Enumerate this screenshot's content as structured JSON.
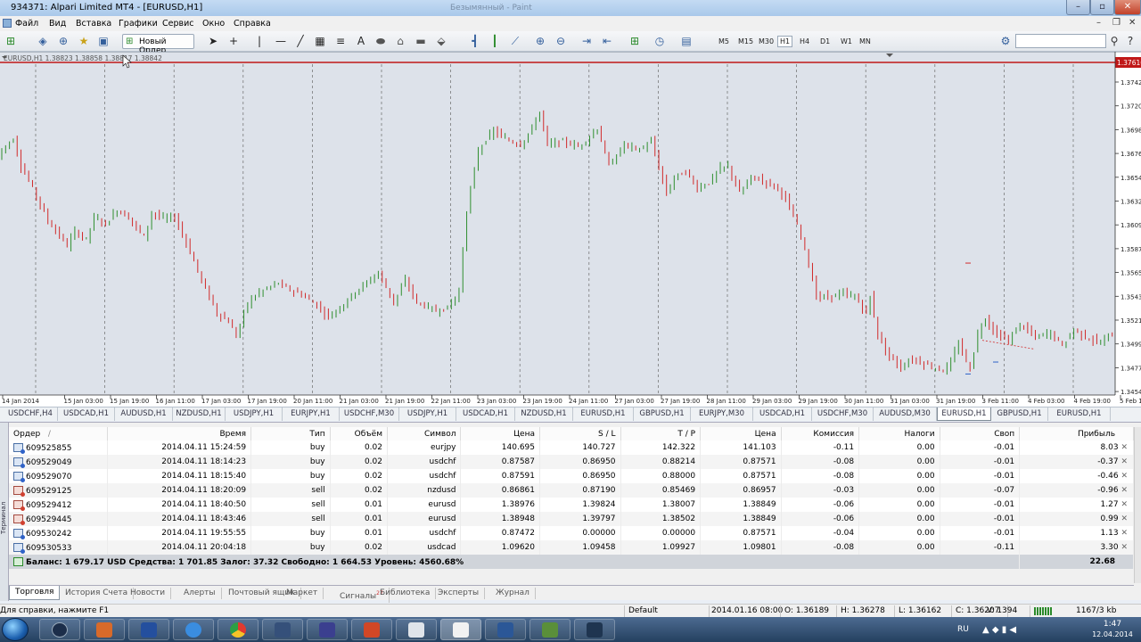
{
  "window": {
    "title": "934371: Alpari Limited MT4 - [EURUSD,H1]",
    "ghost_title": "Безымянный - Paint"
  },
  "menu": [
    "Файл",
    "Вид",
    "Вставка",
    "Графики",
    "Сервис",
    "Окно",
    "Справка"
  ],
  "toolbar": {
    "new_order_label": "Новый Ордер",
    "timeframes": [
      "M5",
      "M15",
      "M30",
      "H1",
      "H4",
      "D1",
      "W1",
      "MN"
    ],
    "active_timeframe": "H1"
  },
  "chart": {
    "header_text": "EURUSD,H1  1.38823 1.38858 1.38817 1.38842",
    "current_price": "1.37616",
    "bull_color": "#2f8f2f",
    "bear_color": "#d12b2b",
    "price_line_color": "#c01818",
    "price_labels": [
      "1.37425",
      "1.37205",
      "1.36985",
      "1.36760",
      "1.36540",
      "1.36320",
      "1.36095",
      "1.35875",
      "1.35655",
      "1.35430",
      "1.35210",
      "1.34990",
      "1.34770",
      "1.34545"
    ],
    "time_labels": [
      "14 Jan 2014",
      "15 Jan 03:00",
      "15 Jan 19:00",
      "16 Jan 11:00",
      "17 Jan 03:00",
      "17 Jan 19:00",
      "20 Jan 11:00",
      "21 Jan 03:00",
      "21 Jan 19:00",
      "22 Jan 11:00",
      "23 Jan 03:00",
      "23 Jan 19:00",
      "24 Jan 11:00",
      "27 Jan 03:00",
      "27 Jan 19:00",
      "28 Jan 11:00",
      "29 Jan 03:00",
      "29 Jan 19:00",
      "30 Jan 11:00",
      "31 Jan 03:00",
      "31 Jan 19:00",
      "3 Feb 11:00",
      "4 Feb 03:00",
      "4 Feb 19:00",
      "5 Feb 11:00"
    ],
    "path_points": [
      [
        1.3672,
        0
      ],
      [
        1.3681,
        1
      ],
      [
        1.369,
        4
      ],
      [
        1.3665,
        6
      ],
      [
        1.3645,
        9
      ],
      [
        1.3615,
        13
      ],
      [
        1.3592,
        18
      ],
      [
        1.3605,
        20
      ],
      [
        1.3598,
        23
      ],
      [
        1.3618,
        25
      ],
      [
        1.3612,
        28
      ],
      [
        1.3625,
        31
      ],
      [
        1.3618,
        34
      ],
      [
        1.36,
        38
      ],
      [
        1.3622,
        40
      ],
      [
        1.3617,
        43
      ],
      [
        1.3618,
        46
      ],
      [
        1.3595,
        49
      ],
      [
        1.356,
        53
      ],
      [
        1.353,
        57
      ],
      [
        1.3522,
        60
      ],
      [
        1.3509,
        62
      ],
      [
        1.354,
        65
      ],
      [
        1.3549,
        68
      ],
      [
        1.3558,
        73
      ],
      [
        1.3553,
        75
      ],
      [
        1.3547,
        79
      ],
      [
        1.3537,
        83
      ],
      [
        1.3527,
        86
      ],
      [
        1.3535,
        89
      ],
      [
        1.355,
        93
      ],
      [
        1.3558,
        96
      ],
      [
        1.3567,
        99
      ],
      [
        1.354,
        103
      ],
      [
        1.356,
        106
      ],
      [
        1.354,
        109
      ],
      [
        1.3532,
        114
      ],
      [
        1.3535,
        117
      ],
      [
        1.355,
        120
      ],
      [
        1.3625,
        122
      ],
      [
        1.368,
        125
      ],
      [
        1.3698,
        129
      ],
      [
        1.369,
        132
      ],
      [
        1.3685,
        136
      ],
      [
        1.37,
        139
      ],
      [
        1.3715,
        141
      ],
      [
        1.3685,
        143
      ],
      [
        1.3688,
        147
      ],
      [
        1.3683,
        151
      ],
      [
        1.3692,
        154
      ],
      [
        1.37,
        156
      ],
      [
        1.3665,
        159
      ],
      [
        1.3685,
        163
      ],
      [
        1.368,
        167
      ],
      [
        1.3688,
        170
      ],
      [
        1.364,
        174
      ],
      [
        1.3655,
        176
      ],
      [
        1.366,
        179
      ],
      [
        1.3645,
        182
      ],
      [
        1.365,
        185
      ],
      [
        1.3663,
        188
      ],
      [
        1.3665,
        190
      ],
      [
        1.364,
        193
      ],
      [
        1.3655,
        196
      ],
      [
        1.3652,
        199
      ],
      [
        1.3645,
        203
      ],
      [
        1.3635,
        205
      ],
      [
        1.361,
        208
      ],
      [
        1.359,
        210
      ],
      [
        1.3545,
        213
      ],
      [
        1.3545,
        216
      ],
      [
        1.3548,
        220
      ],
      [
        1.3545,
        223
      ],
      [
        1.353,
        226
      ],
      [
        1.3545,
        227
      ],
      [
        1.351,
        229
      ],
      [
        1.349,
        232
      ],
      [
        1.348,
        235
      ],
      [
        1.3488,
        238
      ],
      [
        1.3482,
        242
      ],
      [
        1.3477,
        246
      ],
      [
        1.3485,
        248
      ],
      [
        1.3502,
        250
      ],
      [
        1.3478,
        253
      ],
      [
        1.3512,
        255
      ],
      [
        1.3525,
        257
      ],
      [
        1.351,
        260
      ],
      [
        1.3505,
        263
      ],
      [
        1.352,
        266
      ],
      [
        1.3508,
        270
      ],
      [
        1.3512,
        274
      ],
      [
        1.35,
        277
      ],
      [
        1.3515,
        280
      ],
      [
        1.3508,
        283
      ],
      [
        1.3502,
        287
      ],
      [
        1.351,
        289
      ]
    ]
  },
  "chart_tabs": [
    "USDCHF,H4",
    "USDCAD,H1",
    "AUDUSD,H1",
    "NZDUSD,H1",
    "USDJPY,H1",
    "EURJPY,H1",
    "USDCHF,M30",
    "USDJPY,H1",
    "USDCAD,H1",
    "NZDUSD,H1",
    "EURUSD,H1",
    "GBPUSD,H1",
    "EURJPY,M30",
    "USDCAD,H1",
    "USDCHF,M30",
    "AUDUSD,M30",
    "EURUSD,H1",
    "GBPUSD,H1",
    "EURUSD,H1"
  ],
  "chart_tabs_active": 16,
  "terminal": {
    "side_label": "Терминал",
    "columns": [
      "Ордер",
      "/",
      "Время",
      "Тип",
      "Объём",
      "Символ",
      "Цена",
      "S / L",
      "T / P",
      "Цена",
      "Комиссия",
      "Налоги",
      "Своп",
      "Прибыль"
    ],
    "rows": [
      [
        "609525855",
        "",
        "2014.04.11 15:24:59",
        "buy",
        "0.02",
        "eurjpy",
        "140.695",
        "140.727",
        "142.322",
        "141.103",
        "-0.11",
        "0.00",
        "-0.01",
        "8.03"
      ],
      [
        "609529049",
        "",
        "2014.04.11 18:14:23",
        "buy",
        "0.02",
        "usdchf",
        "0.87587",
        "0.86950",
        "0.88214",
        "0.87571",
        "-0.08",
        "0.00",
        "-0.01",
        "-0.37"
      ],
      [
        "609529070",
        "",
        "2014.04.11 18:15:40",
        "buy",
        "0.02",
        "usdchf",
        "0.87591",
        "0.86950",
        "0.88000",
        "0.87571",
        "-0.08",
        "0.00",
        "-0.01",
        "-0.46"
      ],
      [
        "609529125",
        "",
        "2014.04.11 18:20:09",
        "sell",
        "0.02",
        "nzdusd",
        "0.86861",
        "0.87190",
        "0.85469",
        "0.86957",
        "-0.03",
        "0.00",
        "-0.07",
        "-0.96"
      ],
      [
        "609529412",
        "",
        "2014.04.11 18:40:50",
        "sell",
        "0.01",
        "eurusd",
        "1.38976",
        "1.39824",
        "1.38007",
        "1.38849",
        "-0.06",
        "0.00",
        "-0.01",
        "1.27"
      ],
      [
        "609529445",
        "",
        "2014.04.11 18:43:46",
        "sell",
        "0.01",
        "eurusd",
        "1.38948",
        "1.39797",
        "1.38502",
        "1.38849",
        "-0.06",
        "0.00",
        "-0.01",
        "0.99"
      ],
      [
        "609530242",
        "",
        "2014.04.11 19:55:55",
        "buy",
        "0.01",
        "usdchf",
        "0.87472",
        "0.00000",
        "0.00000",
        "0.87571",
        "-0.04",
        "0.00",
        "-0.01",
        "1.13"
      ],
      [
        "609530533",
        "",
        "2014.04.11 20:04:18",
        "buy",
        "0.02",
        "usdcad",
        "1.09620",
        "1.09458",
        "1.09927",
        "1.09801",
        "-0.08",
        "0.00",
        "-0.11",
        "3.30"
      ]
    ],
    "balance_line": "Баланс: 1 679.17 USD  Средства: 1 701.85  Залог: 37.32  Свободно: 1 664.53  Уровень: 4560.68%",
    "total_profit": "22.68",
    "tabs": [
      "Торговля",
      "История Счета",
      "Новости",
      "Алерты",
      "Почтовый ящик",
      "Маркет",
      "Сигналы",
      "Библиотека",
      "Эксперты",
      "Журнал"
    ],
    "signals_badge": "27",
    "active_tab": "Торговля"
  },
  "status": {
    "help": "Для справки, нажмите F1",
    "profile": "Default",
    "datetime": "2014.01.16 08:00",
    "open": "O: 1.36189",
    "high": "H: 1.36278",
    "low": "L: 1.36162",
    "close": "C: 1.36207",
    "volume": "V: 1394",
    "traffic": "1167/3 kb"
  },
  "taskbar": {
    "lang": "RU",
    "time": "1:47",
    "date": "12.04.2014"
  }
}
